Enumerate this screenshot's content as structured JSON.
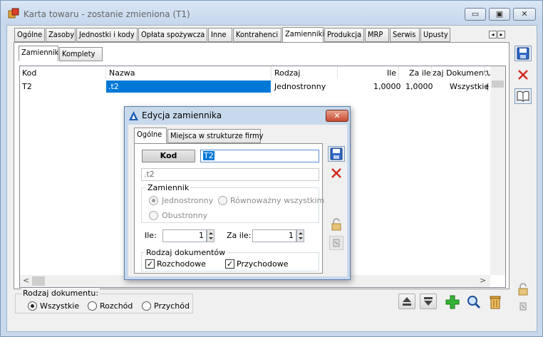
{
  "window": {
    "title": "Karta towaru - zostanie zmieniona (T1)",
    "minimize_glyph": "▭",
    "restore_glyph": "▣",
    "close_glyph": "✕"
  },
  "tabs": [
    {
      "label": "Ogólne"
    },
    {
      "label": "Zasoby"
    },
    {
      "label": "Jednostki i kody"
    },
    {
      "label": "Opłata spożywcza"
    },
    {
      "label": "Inne"
    },
    {
      "label": "Kontrahenci"
    },
    {
      "label": "Zamienniki"
    },
    {
      "label": "Produkcja"
    },
    {
      "label": "MRP"
    },
    {
      "label": "Serwis"
    },
    {
      "label": "Upusty"
    }
  ],
  "tab_scroll": {
    "left": "◂",
    "right": "▸"
  },
  "subtabs": [
    {
      "label": "Zamienniki"
    },
    {
      "label": "Komplety"
    }
  ],
  "grid": {
    "columns": [
      {
        "label": "Kod"
      },
      {
        "label": "Nazwa"
      },
      {
        "label": "Rodzaj"
      },
      {
        "label": "Ile"
      },
      {
        "label": "Za ile"
      },
      {
        "label": "zaj Dokumentu"
      },
      {
        "label": "'"
      }
    ],
    "rows": [
      {
        "kod": "T2",
        "nazwa": ".t2",
        "rodzaj": "Jednostronny",
        "ile": "1,0000",
        "zaile": "1,0000",
        "dok": "Wszystkie",
        "extra": "("
      }
    ],
    "scroll_left": "<",
    "scroll_right": ">"
  },
  "doc_type": {
    "title": "Rodzaj dokumentu:",
    "options": [
      {
        "label": "Wszystkie",
        "checked": true
      },
      {
        "label": "Rozchód",
        "checked": false
      },
      {
        "label": "Przychód",
        "checked": false
      }
    ]
  },
  "dialog": {
    "title": "Edycja zamiennika",
    "close_glyph": "✕",
    "tabs": [
      {
        "label": "Ogólne"
      },
      {
        "label": "Miejsca w strukturze firmy"
      }
    ],
    "kod_button": "Kod",
    "kod_value": "T2",
    "name_value": ".t2",
    "zamiennik": {
      "title": "Zamiennik",
      "options": [
        {
          "label": "Jednostronny",
          "checked": true
        },
        {
          "label": "Równoważny wszystkim",
          "checked": false
        },
        {
          "label": "Obustronny",
          "checked": false
        }
      ]
    },
    "ile_label": "Ile:",
    "ile_value": "1",
    "zaile_label": "Za ile:",
    "zaile_value": "1",
    "rodzaj": {
      "title": "Rodzaj dokumentów",
      "options": [
        {
          "label": "Rozchodowe",
          "checked": true
        },
        {
          "label": "Przychodowe",
          "checked": true
        }
      ]
    },
    "check_glyph": "✓"
  }
}
